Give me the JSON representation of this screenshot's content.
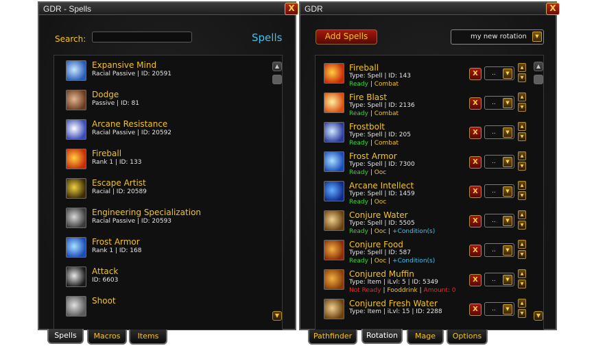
{
  "left_window": {
    "title": "GDR - Spells",
    "close_label": "X",
    "search_label": "Search:",
    "search_value": "",
    "heading": "Spells",
    "spells": [
      {
        "name": "Expansive Mind",
        "sub": "Racial Passive | ID: 20591",
        "icon": "expansive-mind-icon",
        "c1": "#c8e8ff",
        "c2": "#2a5ab8"
      },
      {
        "name": "Dodge",
        "sub": "Passive | ID: 81",
        "icon": "dodge-icon",
        "c1": "#e0b890",
        "c2": "#6a3a20"
      },
      {
        "name": "Arcane Resistance",
        "sub": "Racial Passive | ID: 20592",
        "icon": "arcane-resistance-icon",
        "c1": "#ffffff",
        "c2": "#3a4ab8"
      },
      {
        "name": "Fireball",
        "sub": "Rank 1 | ID: 133",
        "icon": "fireball-icon",
        "c1": "#ffd040",
        "c2": "#c82a08"
      },
      {
        "name": "Escape Artist",
        "sub": "Racial | ID: 20589",
        "icon": "escape-artist-icon",
        "c1": "#f0d040",
        "c2": "#3a2a08"
      },
      {
        "name": "Engineering Specialization",
        "sub": "Racial Passive | ID: 20593",
        "icon": "engineering-icon",
        "c1": "#d8d8d8",
        "c2": "#3a3a3a"
      },
      {
        "name": "Frost Armor",
        "sub": "Rank 1 | ID: 168",
        "icon": "frost-armor-icon",
        "c1": "#a8e0ff",
        "c2": "#1a4ab8"
      },
      {
        "name": "Attack",
        "sub": "ID: 6603",
        "icon": "attack-icon",
        "c1": "#e8e8e8",
        "c2": "#1a1a1a"
      },
      {
        "name": "Shoot",
        "sub": "",
        "icon": "shoot-icon",
        "c1": "#e0e0e0",
        "c2": "#5a5a5a"
      }
    ],
    "tabs": [
      "Spells",
      "Macros",
      "Items"
    ],
    "active_tab": "Spells"
  },
  "right_window": {
    "title": "GDR",
    "close_label": "X",
    "add_button": "Add Spells",
    "rotation_selected": "my new rotation",
    "remove_label": "X",
    "select_value": "..",
    "rotation": [
      {
        "name": "Fireball",
        "sub": "Type: Spell | ID: 143",
        "icon": "fireball-icon",
        "c1": "#ffd040",
        "c2": "#c82a08",
        "status": [
          {
            "t": "Ready",
            "c": "st-ready"
          },
          {
            "t": " | ",
            "c": "st-sep"
          },
          {
            "t": "Combat",
            "c": "st-cat"
          }
        ]
      },
      {
        "name": "Fire Blast",
        "sub": "Type: Spell | ID: 2136",
        "icon": "fire-blast-icon",
        "c1": "#fff0a0",
        "c2": "#d85010",
        "status": [
          {
            "t": "Ready",
            "c": "st-ready"
          },
          {
            "t": " | ",
            "c": "st-sep"
          },
          {
            "t": "Combat",
            "c": "st-cat"
          }
        ]
      },
      {
        "name": "Frostbolt",
        "sub": "Type: Spell | ID: 205",
        "icon": "frostbolt-icon",
        "c1": "#d0e8ff",
        "c2": "#2a3a9a",
        "status": [
          {
            "t": "Ready",
            "c": "st-ready"
          },
          {
            "t": " | ",
            "c": "st-sep"
          },
          {
            "t": "Combat",
            "c": "st-cat"
          }
        ]
      },
      {
        "name": "Frost Armor",
        "sub": "Type: Spell | ID: 7300",
        "icon": "frost-armor-icon",
        "c1": "#a8e0ff",
        "c2": "#1a4ab8",
        "status": [
          {
            "t": "Ready",
            "c": "st-ready"
          },
          {
            "t": " | ",
            "c": "st-sep"
          },
          {
            "t": "Ooc",
            "c": "st-cat"
          }
        ]
      },
      {
        "name": "Arcane Intellect",
        "sub": "Type: Spell | ID: 1459",
        "icon": "arcane-intellect-icon",
        "c1": "#60b0ff",
        "c2": "#102a8a",
        "status": [
          {
            "t": "Ready",
            "c": "st-ready"
          },
          {
            "t": " | ",
            "c": "st-sep"
          },
          {
            "t": "Ooc",
            "c": "st-cat"
          }
        ]
      },
      {
        "name": "Conjure Water",
        "sub": "Type: Spell | ID: 5505",
        "icon": "conjure-water-icon",
        "c1": "#f0d090",
        "c2": "#6a4010",
        "status": [
          {
            "t": "Ready",
            "c": "st-ready"
          },
          {
            "t": " | ",
            "c": "st-sep"
          },
          {
            "t": "Ooc",
            "c": "st-cat"
          },
          {
            "t": " | ",
            "c": "st-sep"
          },
          {
            "t": "+Condition(s)",
            "c": "st-cond"
          }
        ]
      },
      {
        "name": "Conjure Food",
        "sub": "Type: Spell | ID: 587",
        "icon": "conjure-food-icon",
        "c1": "#f0b040",
        "c2": "#8a2a08",
        "status": [
          {
            "t": "Ready",
            "c": "st-ready"
          },
          {
            "t": " | ",
            "c": "st-sep"
          },
          {
            "t": "Ooc",
            "c": "st-cat"
          },
          {
            "t": " | ",
            "c": "st-sep"
          },
          {
            "t": "+Condition(s)",
            "c": "st-cond"
          }
        ]
      },
      {
        "name": "Conjured Muffin",
        "sub": "Type: Item | iLvl: 5 | ID: 5349",
        "icon": "conjured-muffin-icon",
        "c1": "#f0b040",
        "c2": "#8a3a08",
        "status": [
          {
            "t": "Not Ready",
            "c": "st-notready"
          },
          {
            "t": " | ",
            "c": "st-sep"
          },
          {
            "t": "Fooddrink",
            "c": "st-cat"
          },
          {
            "t": " | ",
            "c": "st-sep"
          },
          {
            "t": "Amount: 0",
            "c": "st-red"
          }
        ]
      },
      {
        "name": "Conjured Fresh Water",
        "sub": "Type: Item | iLvl: 15 | ID: 2288",
        "icon": "conjured-fresh-water-icon",
        "c1": "#f0d090",
        "c2": "#6a4010",
        "status": []
      }
    ],
    "tabs": [
      "Pathfinder",
      "Rotation",
      "Mage",
      "Options"
    ],
    "active_tab": "Rotation"
  }
}
